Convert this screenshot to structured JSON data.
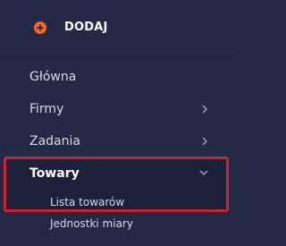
{
  "add": {
    "label": "DODAJ",
    "icon": "plus-circle-icon",
    "icon_color": "#f26522"
  },
  "menu": {
    "items": [
      {
        "label": "Główna"
      },
      {
        "label": "Firmy",
        "icon": "chevron-right-icon"
      },
      {
        "label": "Zadania",
        "icon": "chevron-right-icon"
      },
      {
        "label": "Towary",
        "icon": "chevron-down-icon",
        "expanded": true,
        "children": [
          {
            "label": "Lista towarów"
          },
          {
            "label": "Jednostki miary"
          }
        ]
      }
    ]
  },
  "colors": {
    "background": "#242a45",
    "highlight_border": "#cc2230"
  }
}
